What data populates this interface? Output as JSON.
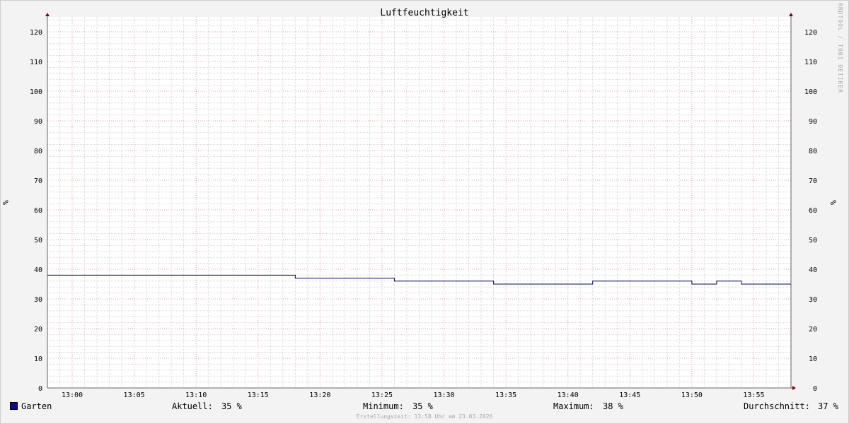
{
  "watermark": "RRDTOOL / TOBI OETIKER",
  "footer": "Erstellungszeit: 13:58 Uhr am 23.03.2026",
  "legend": {
    "name": "Garten",
    "aktuell_label": "Aktuell:",
    "aktuell_value": "35 %",
    "minimum_label": "Minimum:",
    "minimum_value": "35 %",
    "maximum_label": "Maximum:",
    "maximum_value": "38 %",
    "durchschnitt_label": "Durchschnitt:",
    "durchschnitt_value": "37 %"
  },
  "colors": {
    "line": "#000066",
    "swatch": "#0a0aa0",
    "major_grid": "#f0a0a0",
    "minor_grid": "#d8d8d8",
    "axis": "#666666",
    "arrow": "#8b0000"
  },
  "chart_data": {
    "type": "line",
    "title": "Luftfeuchtigkeit",
    "ylabel": "%",
    "ylabel_right": "%",
    "ylim": [
      0,
      125
    ],
    "y_ticks": [
      0,
      10,
      20,
      30,
      40,
      50,
      60,
      70,
      80,
      90,
      100,
      110,
      120
    ],
    "xlim": [
      "12:58",
      "13:58"
    ],
    "x_ticks": [
      "13:00",
      "13:05",
      "13:10",
      "13:15",
      "13:20",
      "13:25",
      "13:30",
      "13:35",
      "13:40",
      "13:45",
      "13:50",
      "13:55"
    ],
    "grid": true,
    "series": [
      {
        "name": "Garten",
        "step": true,
        "points": [
          {
            "x": "12:58",
            "y": 38
          },
          {
            "x": "13:18",
            "y": 37
          },
          {
            "x": "13:26",
            "y": 36
          },
          {
            "x": "13:34",
            "y": 35
          },
          {
            "x": "13:42",
            "y": 36
          },
          {
            "x": "13:50",
            "y": 35
          },
          {
            "x": "13:52",
            "y": 36
          },
          {
            "x": "13:54",
            "y": 35
          },
          {
            "x": "13:58",
            "y": 35
          }
        ]
      }
    ]
  }
}
